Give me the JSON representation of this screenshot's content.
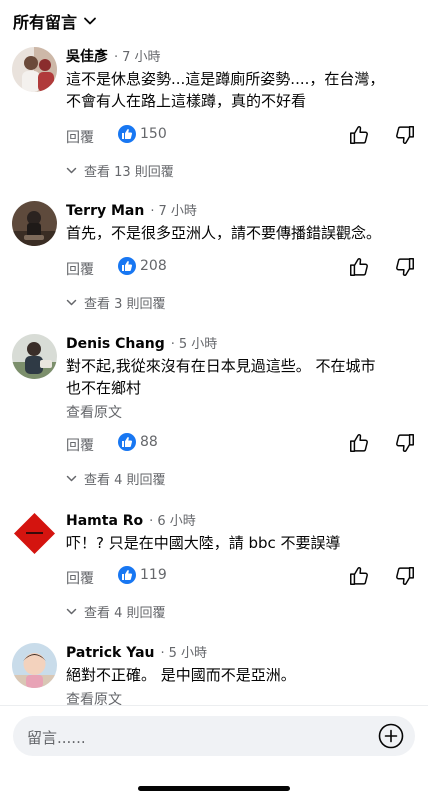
{
  "header": {
    "sort_label": "所有留言"
  },
  "comments": [
    {
      "name": "吳佳彥",
      "time": "7 小時",
      "lines": [
        "這不是休息姿勢...這是蹲廁所姿勢....，在台灣，",
        "不會有人在路上這樣蹲，真的不好看"
      ],
      "reply_label": "回覆",
      "likes": "150",
      "replies_label": "查看 13 則回覆"
    },
    {
      "name": "Terry Man",
      "time": "7 小時",
      "lines": [
        "首先，不是很多亞洲人，請不要傳播錯誤觀念。"
      ],
      "reply_label": "回覆",
      "likes": "208",
      "replies_label": "查看 3 則回覆"
    },
    {
      "name": "Denis Chang",
      "time": "5 小時",
      "lines": [
        "對不起,我從來沒有在日本見過這些。 不在城市",
        "也不在鄉村"
      ],
      "translate_label": "查看原文",
      "reply_label": "回覆",
      "likes": "88",
      "replies_label": "查看 4 則回覆"
    },
    {
      "name": "Hamta Ro",
      "time": "6 小時",
      "lines": [
        "吓！? 只是在中國大陸，請 bbc 不要誤導"
      ],
      "reply_label": "回覆",
      "likes": "119",
      "replies_label": "查看 4 則回覆"
    },
    {
      "name": "Patrick Yau",
      "time": "5 小時",
      "lines": [
        "絕對不正確。 是中國而不是亞洲。"
      ],
      "translate_label": "查看原文"
    }
  ],
  "composer": {
    "placeholder": "留言......"
  },
  "colors": {
    "like_blue": "#1877f2",
    "secondary_text": "#65676b",
    "input_bg": "#f0f2f5"
  },
  "icons": [
    "chevron-down-icon",
    "like-icon",
    "thumbs-up-icon",
    "thumbs-down-icon",
    "add-icon"
  ]
}
